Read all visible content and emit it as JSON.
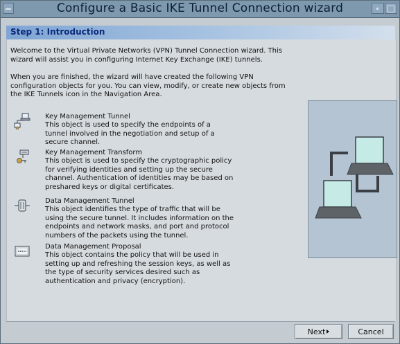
{
  "window": {
    "title": "Configure a Basic IKE Tunnel Connection wizard"
  },
  "step": {
    "title": "Step 1: Introduction"
  },
  "intro": {
    "welcome_line1": "Welcome to the Virtual Private Networks (VPN) Tunnel Connection wizard.  This",
    "welcome_line2": "wizard will assist you in configuring Internet Key Exchange (IKE) tunnels.",
    "finish_line1": "When you are finished, the wizard will have created the following VPN",
    "finish_line2": "configuration objects for you.  You can view, modify, or create new objects from",
    "finish_line3": "the IKE Tunnels icon in the Navigation Area."
  },
  "items": [
    {
      "icon": "key-management-tunnel-icon",
      "title": "Key Management Tunnel",
      "lines": [
        "This object is used to specify the endpoints of a",
        "tunnel involved in the negotiation and setup of a",
        "secure channel."
      ]
    },
    {
      "icon": "key-management-transform-icon",
      "title": "Key Management Transform",
      "lines": [
        "This object is used to specify the cryptographic policy",
        "for verifying identities and setting up the secure",
        "channel. Authentication of identities may be based on",
        "preshared keys or digital certificates."
      ]
    },
    {
      "icon": "data-management-tunnel-icon",
      "title": "Data Management Tunnel",
      "lines": [
        "This object identifies the type of traffic that will be",
        "using the secure tunnel. It includes information on the",
        "endpoints and network masks, and port and protocol",
        "numbers of the packets using the tunnel."
      ]
    },
    {
      "icon": "data-management-proposal-icon",
      "title": "Data Management Proposal",
      "lines": [
        "This object contains the policy that will be used in",
        "setting up and refreshing the session keys, as well as",
        "the type of security services desired such as",
        "authentication and privacy (encryption)."
      ]
    }
  ],
  "buttons": {
    "next": "Next",
    "cancel": "Cancel"
  },
  "colors": {
    "titlebar": "#7e98ae",
    "step_title": "#0a2a7a",
    "diagram_bg": "#b5c4d2"
  }
}
